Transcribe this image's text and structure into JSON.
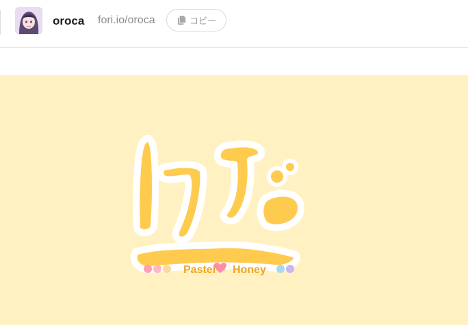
{
  "header": {
    "username": "oroca",
    "profile_url": "fori.io/oroca",
    "copy_label": "コピー"
  },
  "icons": {
    "copy": "copy-icon",
    "avatar": "avatar-image"
  },
  "banner": {
    "background_color": "#fff1c1",
    "logo_text": "ぱすはに",
    "logo_subtitle_left": "Pastel",
    "logo_subtitle_right": "Honey"
  },
  "colors": {
    "logo_yellow": "#ffcb4f",
    "logo_stroke": "#ffffff"
  }
}
